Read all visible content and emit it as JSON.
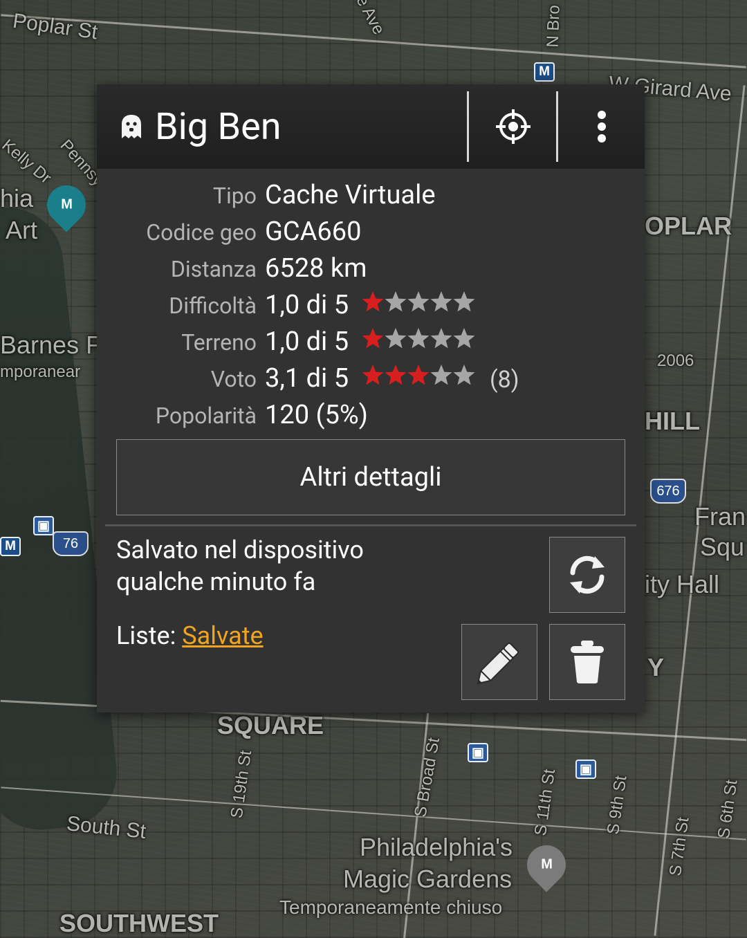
{
  "map": {
    "labels": {
      "poplar_st": "Poplar St",
      "kelly_dr": "Kelly Dr",
      "pennsy": "Pennsy",
      "museum_1": "hia",
      "museum_2": "Art",
      "barnes_1": "Barnes F",
      "barnes_2": "mporanear",
      "girard_ave": "W Girard Ave",
      "poplar": "OPLAR",
      "n_broad": "N Bro",
      "ave": "e Ave",
      "year_2006": "2006",
      "hill": "HILL",
      "fran_1": "Fran",
      "fran_2": "Squ",
      "city_hall": "ity Hall",
      "y_label": "Y",
      "square": "SQUARE",
      "s_19th": "S 19th St",
      "s_broad": "S Broad St",
      "s_11th": "S 11th St",
      "s_9th": "S 9th St",
      "s_7th": "S 7th St",
      "s_6th": "S 6th St",
      "south_st": "South St",
      "magic_1": "Philadelphia's",
      "magic_2": "Magic Gardens",
      "magic_3": "Temporaneamente chiuso",
      "southwest": "SOUTHWEST",
      "highway_76": "76",
      "highway_676": "676",
      "metro": "M"
    }
  },
  "popup": {
    "title": "Big Ben",
    "fields": [
      {
        "key": "Tipo",
        "value": "Cache Virtuale"
      },
      {
        "key": "Codice geo",
        "value": "GCA660"
      },
      {
        "key": "Distanza",
        "value": "6528 km"
      },
      {
        "key": "Difficoltà",
        "value": "1,0 di 5",
        "stars": 1
      },
      {
        "key": "Terreno",
        "value": "1,0 di 5",
        "stars": 1
      },
      {
        "key": "Voto",
        "value": "3,1 di 5",
        "stars": 3,
        "votes": "(8)"
      },
      {
        "key": "Popolarità",
        "value": "120 (5%)"
      }
    ],
    "more_details_label": "Altri dettagli",
    "saved_line1": "Salvato nel dispositivo",
    "saved_line2": "qualche minuto fa",
    "lists_prefix": "Liste: ",
    "lists_link": "Salvate",
    "colors": {
      "star_filled": "#d81e1e",
      "star_empty": "#a6a6a6",
      "link": "#f0a521"
    }
  }
}
